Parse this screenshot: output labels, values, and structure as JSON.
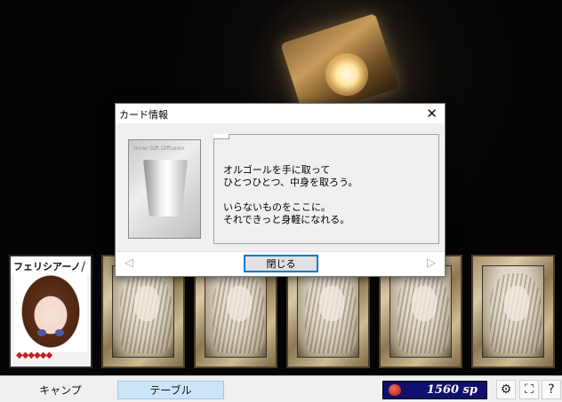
{
  "party": {
    "member_name": "フェリシアーノ",
    "hearts": "◆◆◆◆◆◆"
  },
  "dialog": {
    "title": "カード情報",
    "close_symbol": "✕",
    "card_thumb_label": "Inner Gift Diffusion",
    "description_lines": [
      "オルゴールを手に取って",
      "ひとつひとつ、中身を取ろう。",
      "",
      "いらないものをここに。",
      "それできっと身軽になれる。"
    ],
    "prev_arrow": "◁",
    "next_arrow": "▷",
    "close_button_label": "閉じる"
  },
  "bottom_bar": {
    "camp_label": "キャンプ",
    "table_label": "テーブル",
    "money_text": "1560 sp",
    "settings_symbol": "⚙",
    "fullscreen_symbol": "⛶",
    "help_symbol": "?"
  },
  "colors": {
    "money_bg": "#10106e",
    "active_tab": "#cce4f7",
    "focus_border": "#0078d7"
  }
}
